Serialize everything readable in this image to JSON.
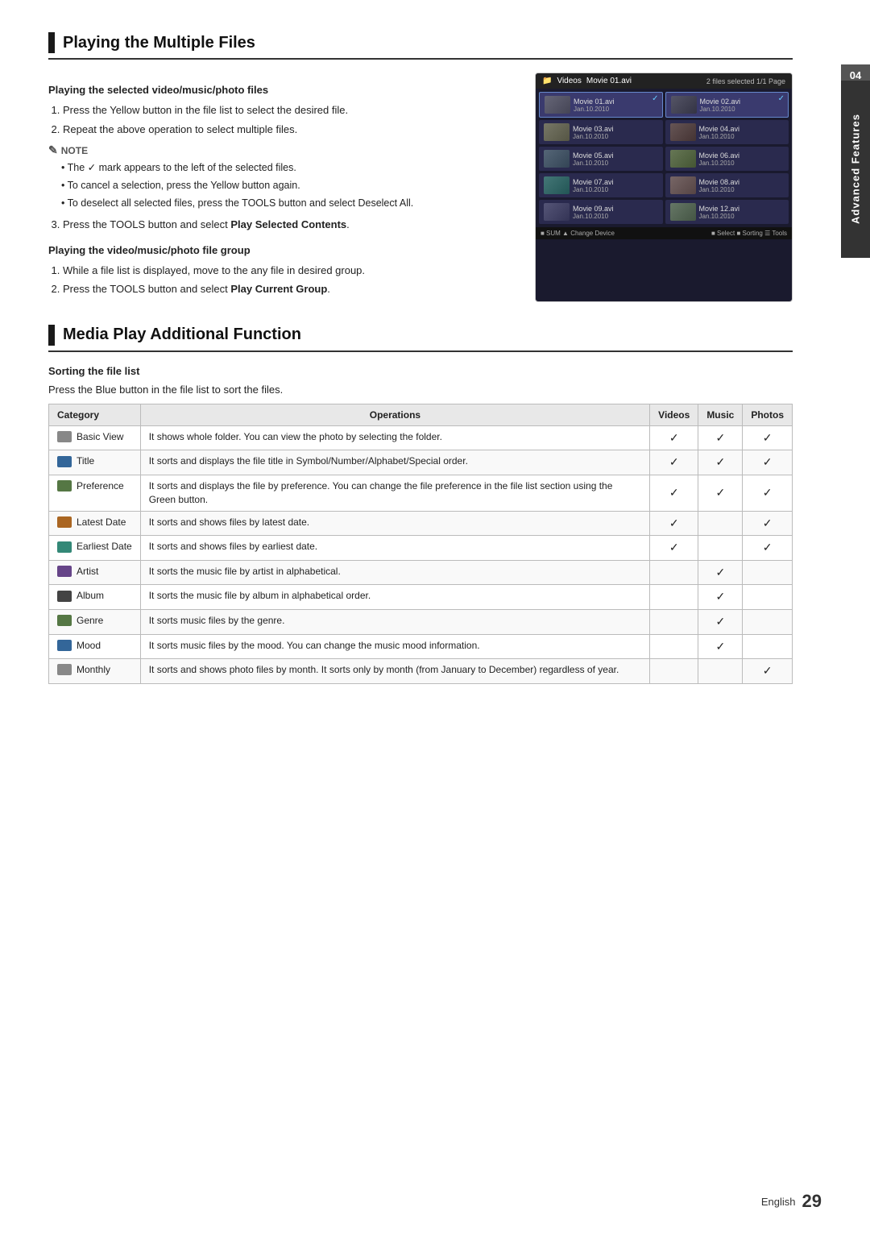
{
  "page": {
    "number": "29",
    "language": "English"
  },
  "side_tab": {
    "number": "04",
    "label": "Advanced Features"
  },
  "section1": {
    "title": "Playing the Multiple Files",
    "sub1": {
      "heading": "Playing the selected video/music/photo files",
      "steps": [
        "Press the Yellow button in the file list to select the desired file.",
        "Repeat the above operation to select multiple files."
      ],
      "note_label": "NOTE",
      "notes": [
        "The ✓ mark appears to the left of the selected files.",
        "To cancel a selection, press the Yellow button again.",
        "To deselect all selected files, press the TOOLS button and select Deselect All."
      ],
      "step3": "Press the TOOLS button and select Play Selected Contents."
    },
    "sub2": {
      "heading": "Playing the video/music/photo file group",
      "steps": [
        "While a file list is displayed, move to the any file in desired group.",
        "Press the TOOLS button and select Play Current Group."
      ]
    }
  },
  "panel": {
    "header_left": "Videos",
    "header_title": "Movie 01.avi",
    "header_right": "2 files selected  1/1 Page",
    "cells": [
      {
        "name": "Movie 01.avi",
        "date": "Jan.10.2010",
        "selected": true
      },
      {
        "name": "Movie 02.avi",
        "date": "Jan.10.2010",
        "selected": true
      },
      {
        "name": "Movie 03.avi",
        "date": "Jan.10.2010",
        "selected": false
      },
      {
        "name": "Movie 04.avi",
        "date": "Jan.10.2010",
        "selected": false
      },
      {
        "name": "Movie 05.avi",
        "date": "Jan.10.2010",
        "selected": false
      },
      {
        "name": "Movie 06.avi",
        "date": "Jan.10.2010",
        "selected": false
      },
      {
        "name": "Movie 07.avi",
        "date": "Jan.10.2010",
        "selected": false
      },
      {
        "name": "Movie 08.avi",
        "date": "Jan.10.2010",
        "selected": false
      },
      {
        "name": "Movie 09.avi",
        "date": "Jan.10.2010",
        "selected": false
      },
      {
        "name": "Movie 12.avi",
        "date": "Jan.10.2010",
        "selected": false
      }
    ],
    "footer_left": "■ SUM  ▲ Change Device",
    "footer_right": "■ Select  ■ Sorting  ☰ Tools"
  },
  "section2": {
    "title": "Media Play Additional Function",
    "sorting": {
      "heading": "Sorting the file list",
      "description": "Press the Blue button in the file list to sort the files.",
      "table": {
        "headers": [
          "Category",
          "Operations",
          "Videos",
          "Music",
          "Photos"
        ],
        "rows": [
          {
            "category": "Basic View",
            "icon_color": "gray",
            "operations": "It shows whole folder. You can view the photo by selecting the folder.",
            "videos": true,
            "music": true,
            "photos": true
          },
          {
            "category": "Title",
            "icon_color": "blue",
            "operations": "It sorts and displays the file title in Symbol/Number/Alphabet/Special order.",
            "videos": true,
            "music": true,
            "photos": true
          },
          {
            "category": "Preference",
            "icon_color": "green",
            "operations": "It sorts and displays the file by preference. You can change the file preference in the file list section using the Green button.",
            "videos": true,
            "music": true,
            "photos": true
          },
          {
            "category": "Latest Date",
            "icon_color": "orange",
            "operations": "It sorts and shows files by latest date.",
            "videos": true,
            "music": false,
            "photos": true
          },
          {
            "category": "Earliest Date",
            "icon_color": "teal",
            "operations": "It sorts and shows files by earliest date.",
            "videos": true,
            "music": false,
            "photos": true
          },
          {
            "category": "Artist",
            "icon_color": "purple",
            "operations": "It sorts the music file by artist in alphabetical.",
            "videos": false,
            "music": true,
            "photos": false
          },
          {
            "category": "Album",
            "icon_color": "dark",
            "operations": "It sorts the music file by album in alphabetical order.",
            "videos": false,
            "music": true,
            "photos": false
          },
          {
            "category": "Genre",
            "icon_color": "green",
            "operations": "It sorts music files by the genre.",
            "videos": false,
            "music": true,
            "photos": false
          },
          {
            "category": "Mood",
            "icon_color": "blue",
            "operations": "It sorts music files by the mood. You can change the music mood information.",
            "videos": false,
            "music": true,
            "photos": false
          },
          {
            "category": "Monthly",
            "icon_color": "gray",
            "operations": "It sorts and shows photo files by month. It sorts only by month (from January to December) regardless of year.",
            "videos": false,
            "music": false,
            "photos": true
          }
        ]
      }
    }
  }
}
